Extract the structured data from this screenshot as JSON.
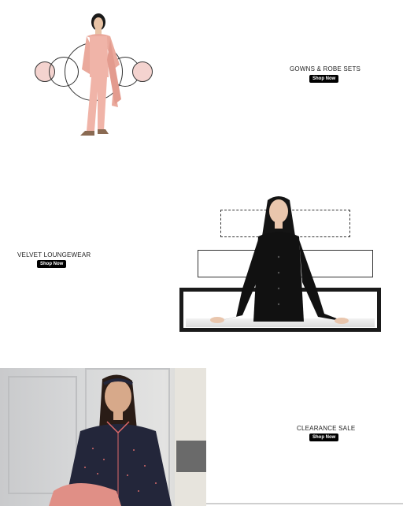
{
  "sections": [
    {
      "label": "GOWNS & ROBE SETS",
      "button": "Shop Now"
    },
    {
      "label": "VELVET LOUNGEWEAR",
      "button": "Shop Now"
    },
    {
      "label": "CLEARANCE SALE",
      "button": "Shop Now"
    }
  ],
  "colors": {
    "button_bg": "#000000",
    "button_text": "#ffffff",
    "pink_set": "#f0b4a8",
    "black_set": "#111111",
    "navy_set": "#23263a"
  }
}
